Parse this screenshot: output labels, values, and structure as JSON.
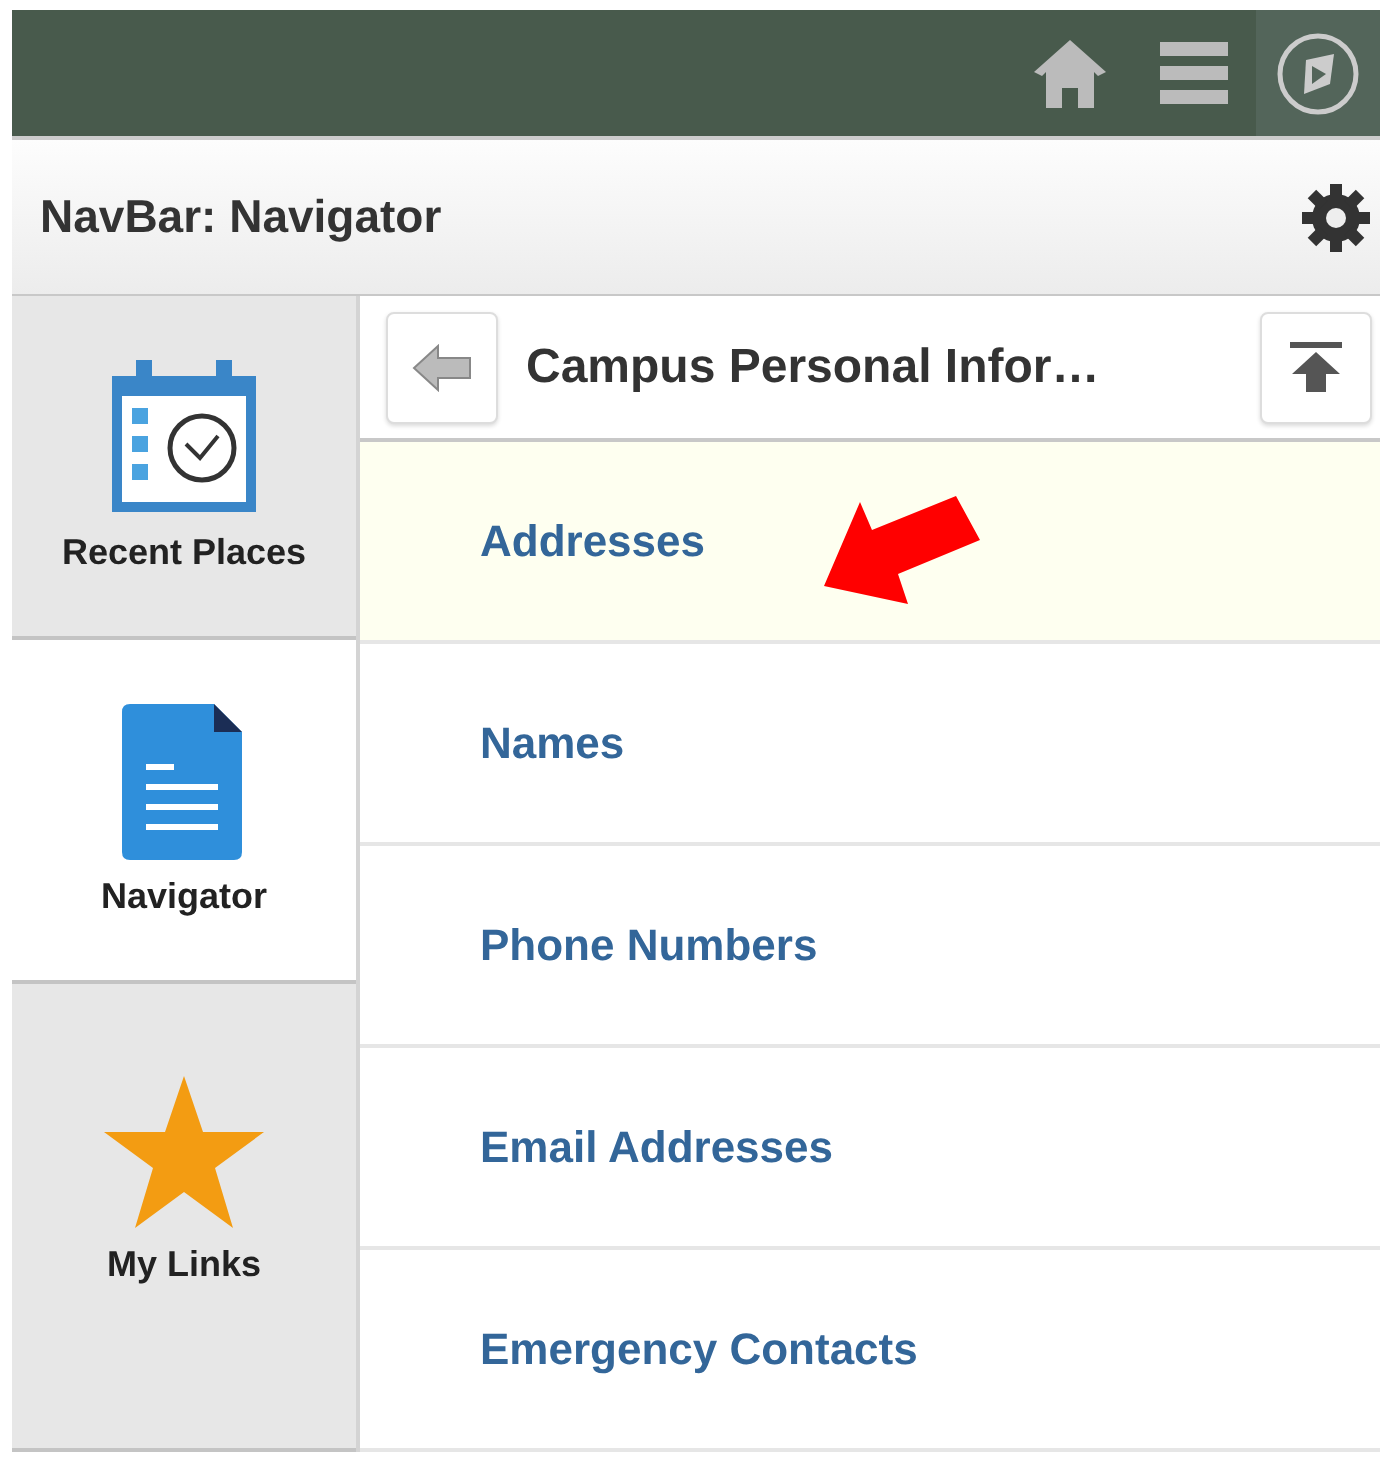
{
  "title_bar": {
    "title": "NavBar: Navigator"
  },
  "sidebar": {
    "items": [
      {
        "label": "Recent Places",
        "kind": "calendar",
        "selected": false
      },
      {
        "label": "Navigator",
        "kind": "document",
        "selected": true
      },
      {
        "label": "My Links",
        "kind": "star",
        "selected": false
      }
    ]
  },
  "panel": {
    "title": "Campus Personal Infor…",
    "items": [
      {
        "label": "Addresses",
        "selected": true
      },
      {
        "label": "Names",
        "selected": false
      },
      {
        "label": "Phone Numbers",
        "selected": false
      },
      {
        "label": "Email Addresses",
        "selected": false
      },
      {
        "label": "Emergency Contacts",
        "selected": false
      }
    ]
  }
}
